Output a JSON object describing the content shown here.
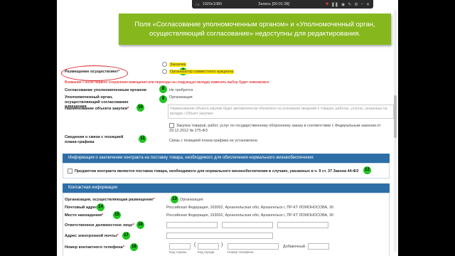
{
  "recorder": {
    "resolution": "1920x1080",
    "status": "Запись [00:01:38]"
  },
  "banner": {
    "text": "Поля «Согласование уполномоченным органом» и «Уполномоченный орган, осуществляющий согласование» недоступны для редактирования."
  },
  "form": {
    "placement_label": "Размещение осуществляет",
    "placement_options": [
      "Заказчик",
      "Организатор совместного аукциона"
    ],
    "placement_warning": "Внимание! После первого сохранения извещения или перехода на следующую вкладку изменить выбор будет невозможно",
    "approval_label": "Согласование уполномоченным органом",
    "approval_value": "Не требуется",
    "auth_org_label": "Уполномоченный орган, осуществляющий согласование извещения",
    "auth_org_value": "Организация",
    "purchase_name_label": "Наименование объекта закупки",
    "purchase_name_placeholder": "Наименование объекта закупки будет автоматически обновлено на основании сведений о товарах, работах, услугах, указанных на вкладке «Объект закупки»",
    "gov_defense_checkbox": "Закупка товаров, работ, услуг по государственному оборонному заказу в соответствии с Федеральным законом от 29.12.2012 № 275-ФЗ",
    "plan_label": "Сведения о связи с позицией плана-графика",
    "plan_value": "Связь с позицией плана-графика не установлена"
  },
  "contract_section": {
    "title": "Информация о заключении контракта на поставку товара, необходимого для обеспечения нормального жизнеобеспечения",
    "checkbox": "Предметом контракта является поставка товара, необходимого для нормального жизнеобеспечения в случаях, указанных в ч. 9 ст. 37 Закона 44-ФЗ"
  },
  "contact_section": {
    "title": "Контактная информация",
    "org_label": "Организация, осуществляющая размещение",
    "org_value": "Организация",
    "postal_label": "Почтовый адрес",
    "postal_value": "Российская Федерация, 163002, Архангельская обл, Архангельск г, ПР-КТ ЛОМОНОСОВА, 30",
    "location_label": "Место нахождения",
    "location_value": "Российская Федерация, 163002, Архангельская обл, Архангельск г, ПР-КТ ЛОМОНОСОВА, 30",
    "responsible_label": "Ответственное должностное лицо",
    "email_label": "Адрес электронной почты",
    "phone_label": "Номер контактного телефона",
    "phone_code_country": "Код страны",
    "phone_code_city": "Код города",
    "phone_number": "Номер телефона",
    "phone_ext": "Добавочный"
  },
  "badges": [
    "7",
    "8",
    "9",
    "10",
    "11",
    "12",
    "13",
    "14",
    "15",
    "16",
    "17",
    "18"
  ],
  "colors": {
    "banner": "#86b81e",
    "section": "#2e6ea7",
    "badge": "#22c422",
    "highlight": "#ffe600",
    "warning": "#d00000"
  }
}
